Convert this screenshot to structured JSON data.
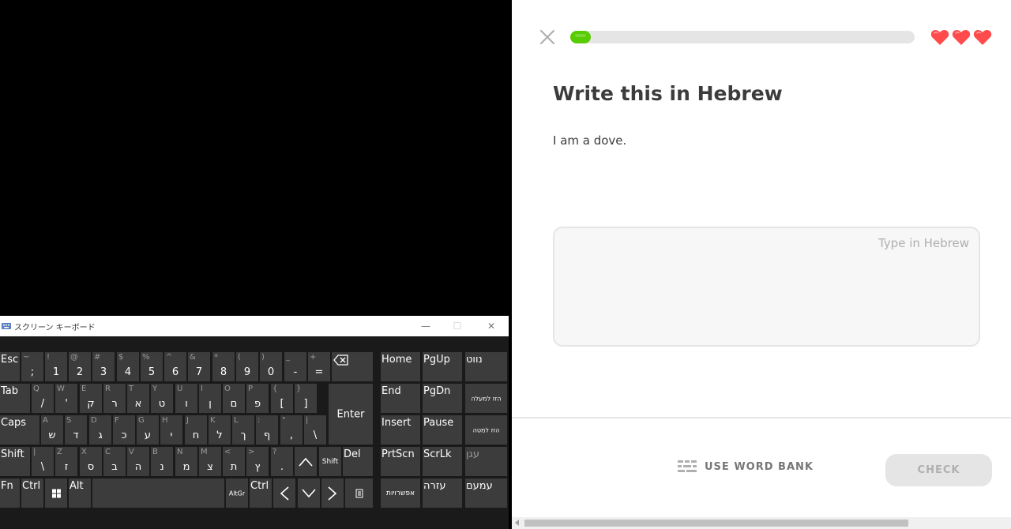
{
  "keyboard": {
    "title": "スクリーン キーボード",
    "minimize_glyph": "—",
    "maximize_glyph": "☐",
    "close_glyph": "✕",
    "rows": {
      "r1": [
        {
          "id": "esc",
          "lab": "Esc"
        },
        {
          "id": "tilde",
          "sub": "~",
          "main": ";"
        },
        {
          "id": "k1",
          "sub": "!",
          "main": "1"
        },
        {
          "id": "k2",
          "sub": "@",
          "main": "2"
        },
        {
          "id": "k3",
          "sub": "#",
          "main": "3"
        },
        {
          "id": "k4",
          "sub": "$",
          "main": "4"
        },
        {
          "id": "k5",
          "sub": "%",
          "main": "5"
        },
        {
          "id": "k6",
          "sub": "^",
          "main": "6"
        },
        {
          "id": "k7",
          "sub": "&",
          "main": "7"
        },
        {
          "id": "k8",
          "sub": "*",
          "main": "8"
        },
        {
          "id": "k9",
          "sub": "(",
          "main": "9"
        },
        {
          "id": "k0",
          "sub": ")",
          "main": "0"
        },
        {
          "id": "minus",
          "sub": "_",
          "main": "-"
        },
        {
          "id": "equals",
          "sub": "+",
          "main": "="
        },
        {
          "id": "backspace",
          "icon": "backspace"
        }
      ],
      "r2": [
        {
          "id": "tab",
          "lab": "Tab"
        },
        {
          "id": "q",
          "sub": "Q",
          "main": "/"
        },
        {
          "id": "w",
          "sub": "W",
          "main": "'"
        },
        {
          "id": "e",
          "sub": "E",
          "main": "ק"
        },
        {
          "id": "r",
          "sub": "R",
          "main": "ר"
        },
        {
          "id": "t",
          "sub": "T",
          "main": "א"
        },
        {
          "id": "y",
          "sub": "Y",
          "main": "ט"
        },
        {
          "id": "u",
          "sub": "U",
          "main": "ו"
        },
        {
          "id": "i",
          "sub": "I",
          "main": "ן"
        },
        {
          "id": "o",
          "sub": "O",
          "main": "ם"
        },
        {
          "id": "p",
          "sub": "P",
          "main": "פ"
        },
        {
          "id": "lbracket",
          "sub": "{",
          "main": "["
        },
        {
          "id": "rbracket",
          "sub": "}",
          "main": "]"
        },
        {
          "id": "enter",
          "center": "Enter"
        }
      ],
      "r3": [
        {
          "id": "caps",
          "lab": "Caps"
        },
        {
          "id": "a",
          "sub": "A",
          "main": "ש"
        },
        {
          "id": "s",
          "sub": "S",
          "main": "ד"
        },
        {
          "id": "d",
          "sub": "D",
          "main": "ג"
        },
        {
          "id": "f",
          "sub": "F",
          "main": "כ"
        },
        {
          "id": "g",
          "sub": "G",
          "main": "ע"
        },
        {
          "id": "h",
          "sub": "H",
          "main": "י"
        },
        {
          "id": "j",
          "sub": "J",
          "main": "ח"
        },
        {
          "id": "k",
          "sub": "K",
          "main": "ל"
        },
        {
          "id": "l",
          "sub": "L",
          "main": "ך"
        },
        {
          "id": "semicolon",
          "sub": ":",
          "main": "ף"
        },
        {
          "id": "quote",
          "sub": "\"",
          "main": ","
        },
        {
          "id": "backslash",
          "sub": "|",
          "main": "\\"
        }
      ],
      "r4": [
        {
          "id": "lshift",
          "lab": "Shift"
        },
        {
          "id": "oem102",
          "sub": "|",
          "main": "\\"
        },
        {
          "id": "z",
          "sub": "Z",
          "main": "ז"
        },
        {
          "id": "x",
          "sub": "X",
          "main": "ס"
        },
        {
          "id": "c",
          "sub": "C",
          "main": "ב"
        },
        {
          "id": "v",
          "sub": "V",
          "main": "ה"
        },
        {
          "id": "b",
          "sub": "B",
          "main": "נ"
        },
        {
          "id": "n",
          "sub": "N",
          "main": "מ"
        },
        {
          "id": "m",
          "sub": "M",
          "main": "צ"
        },
        {
          "id": "comma",
          "sub": "<",
          "main": "ת"
        },
        {
          "id": "period",
          "sub": ">",
          "main": "ץ"
        },
        {
          "id": "slash",
          "sub": "?",
          "main": "."
        },
        {
          "id": "up",
          "icon": "up"
        },
        {
          "id": "rshift",
          "center": "Shift",
          "small": true
        },
        {
          "id": "del",
          "lab": "Del"
        }
      ],
      "r5": [
        {
          "id": "fn",
          "lab": "Fn"
        },
        {
          "id": "lctrl",
          "lab": "Ctrl"
        },
        {
          "id": "win",
          "icon": "windows"
        },
        {
          "id": "alt",
          "lab": "Alt"
        },
        {
          "id": "space",
          "lab": ""
        },
        {
          "id": "altgr",
          "center": "AltGr",
          "xsmall": true
        },
        {
          "id": "rctrl",
          "lab": "Ctrl"
        },
        {
          "id": "left",
          "icon": "left"
        },
        {
          "id": "down",
          "icon": "down"
        },
        {
          "id": "right",
          "icon": "right"
        },
        {
          "id": "menu",
          "icon": "menu"
        }
      ],
      "nav1": [
        {
          "id": "home",
          "lab": "Home"
        },
        {
          "id": "pgup",
          "lab": "PgUp"
        },
        {
          "id": "nav",
          "lab": "נווט"
        }
      ],
      "nav2": [
        {
          "id": "end",
          "lab": "End"
        },
        {
          "id": "pgdn",
          "lab": "PgDn"
        },
        {
          "id": "moveup",
          "center": "הזז למעלה",
          "xsmall": true
        }
      ],
      "nav3": [
        {
          "id": "insert",
          "lab": "Insert"
        },
        {
          "id": "pause",
          "lab": "Pause"
        },
        {
          "id": "movedown",
          "center": "הזז למטה",
          "xsmall": true
        }
      ],
      "nav4": [
        {
          "id": "prtscn",
          "lab": "PrtScn"
        },
        {
          "id": "scrlk",
          "lab": "ScrLk"
        },
        {
          "id": "dock",
          "lab": "עגן",
          "dim": true
        }
      ],
      "nav5": [
        {
          "id": "options",
          "center": "אפשרויות",
          "small": true
        },
        {
          "id": "help",
          "lab": "עזרה"
        },
        {
          "id": "fade",
          "lab": "עמעם"
        }
      ]
    }
  },
  "lesson": {
    "progress_fraction": 0.06,
    "hearts": 3,
    "title": "Write this in Hebrew",
    "sentence": "I am a dove.",
    "answer_value": "",
    "answer_placeholder": "Type in Hebrew",
    "word_bank_label": "USE WORD BANK",
    "check_label": "CHECK",
    "colors": {
      "progress": "#58cc02",
      "heart": "#ff4b4b",
      "text": "#3c3c3c",
      "muted": "#afafaf"
    }
  }
}
